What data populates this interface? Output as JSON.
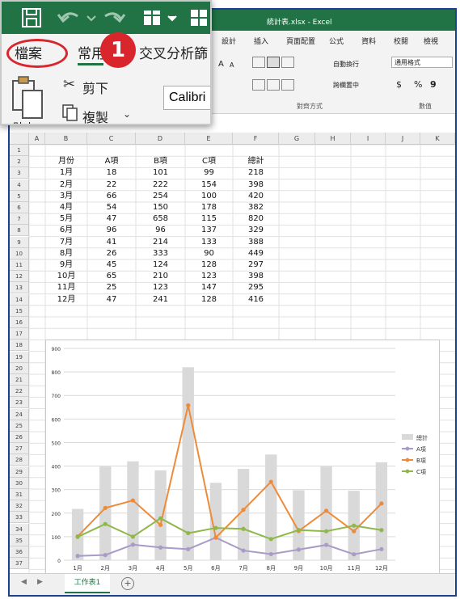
{
  "window": {
    "title": "統計表.xlsx - Excel"
  },
  "ribbon_tabs": [
    "設計",
    "插入",
    "頁面配置",
    "公式",
    "資料",
    "校閱",
    "檢視"
  ],
  "ribbon": {
    "font_grow": "A",
    "font_shrink": "A",
    "wrap_text": "自動換行",
    "merge_center": "跨欄置中",
    "alignment_group": "對齊方式",
    "number_format": "通用格式",
    "number_group": "數值",
    "currency": "$",
    "percent": "%",
    "comma": "9"
  },
  "zoom_overlay": {
    "tab_file": "檔案",
    "tab_home": "常用",
    "tab_partial": "交叉分析篩",
    "step_number": "1",
    "cut_label": "剪下",
    "copy_label": "複製",
    "paste_label": "貼上",
    "font_name": "Calibri"
  },
  "columns": [
    "A",
    "B",
    "C",
    "D",
    "E",
    "F",
    "G",
    "H",
    "I",
    "J",
    "K"
  ],
  "rows": [
    "1",
    "2",
    "3",
    "4",
    "5",
    "6",
    "7",
    "8",
    "9",
    "10",
    "11",
    "12",
    "13",
    "14",
    "15",
    "16",
    "17",
    "18",
    "19",
    "20",
    "21",
    "22",
    "23",
    "24",
    "25",
    "26",
    "27",
    "28",
    "29",
    "30",
    "31",
    "32",
    "33",
    "34",
    "35",
    "36",
    "37"
  ],
  "table": {
    "headers": [
      "月份",
      "A項",
      "B項",
      "C項",
      "總計"
    ],
    "rows": [
      [
        "1月",
        "18",
        "101",
        "99",
        "218"
      ],
      [
        "2月",
        "22",
        "222",
        "154",
        "398"
      ],
      [
        "3月",
        "66",
        "254",
        "100",
        "420"
      ],
      [
        "4月",
        "54",
        "150",
        "178",
        "382"
      ],
      [
        "5月",
        "47",
        "658",
        "115",
        "820"
      ],
      [
        "6月",
        "96",
        "96",
        "137",
        "329"
      ],
      [
        "7月",
        "41",
        "214",
        "133",
        "388"
      ],
      [
        "8月",
        "26",
        "333",
        "90",
        "449"
      ],
      [
        "9月",
        "45",
        "124",
        "128",
        "297"
      ],
      [
        "10月",
        "65",
        "210",
        "123",
        "398"
      ],
      [
        "11月",
        "25",
        "123",
        "147",
        "295"
      ],
      [
        "12月",
        "47",
        "241",
        "128",
        "416"
      ]
    ]
  },
  "chart_data": {
    "type": "bar",
    "categories": [
      "1月",
      "2月",
      "3月",
      "4月",
      "5月",
      "6月",
      "7月",
      "8月",
      "9月",
      "10月",
      "11月",
      "12月"
    ],
    "series": [
      {
        "name": "總計",
        "kind": "bar",
        "color": "#d9d9d9",
        "values": [
          218,
          398,
          420,
          382,
          820,
          329,
          388,
          449,
          297,
          398,
          295,
          416
        ]
      },
      {
        "name": "A項",
        "kind": "line",
        "color": "#a99bc7",
        "values": [
          18,
          22,
          66,
          54,
          47,
          96,
          41,
          26,
          45,
          65,
          25,
          47
        ]
      },
      {
        "name": "B項",
        "kind": "line",
        "color": "#ed8b3a",
        "values": [
          101,
          222,
          254,
          150,
          658,
          96,
          214,
          333,
          124,
          210,
          123,
          241
        ]
      },
      {
        "name": "C項",
        "kind": "line",
        "color": "#8fb84a",
        "values": [
          99,
          154,
          100,
          178,
          115,
          137,
          133,
          90,
          128,
          123,
          147,
          128
        ]
      }
    ],
    "ylim": [
      0,
      900
    ],
    "yticks": [
      0,
      100,
      200,
      300,
      400,
      500,
      600,
      700,
      800,
      900
    ],
    "legend": "right",
    "grid": true,
    "title": "",
    "xlabel": "",
    "ylabel": ""
  },
  "sheet": {
    "tab": "工作表1",
    "add": "+"
  },
  "colors": {
    "excel_green": "#217346",
    "highlight_red": "#d9262c"
  }
}
